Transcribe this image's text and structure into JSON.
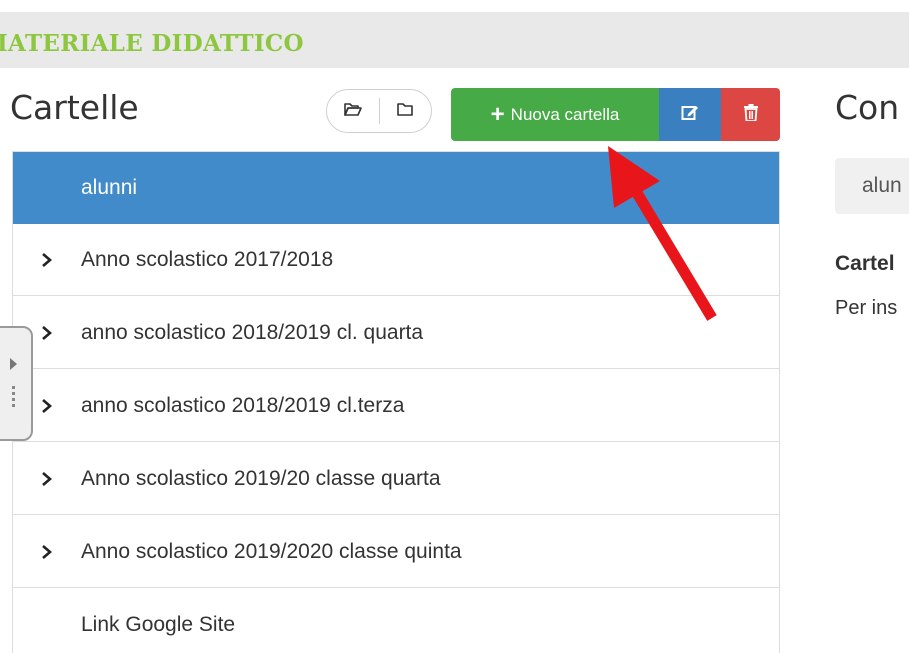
{
  "banner": {
    "title": "IATERIALE DIDATTICO"
  },
  "folders_panel": {
    "title": "Cartelle",
    "expand_all_icon": "folder-open-icon",
    "collapse_all_icon": "folder-icon",
    "new_folder_label": "Nuova cartella",
    "edit_icon": "edit-icon",
    "delete_icon": "trash-icon",
    "items": [
      {
        "label": "alunni",
        "active": true,
        "expandable": false
      },
      {
        "label": "Anno scolastico 2017/2018",
        "active": false,
        "expandable": true
      },
      {
        "label": "anno scolastico 2018/2019 cl. quarta",
        "active": false,
        "expandable": true
      },
      {
        "label": "anno scolastico 2018/2019 cl.terza",
        "active": false,
        "expandable": true
      },
      {
        "label": "Anno scolastico 2019/20 classe quarta",
        "active": false,
        "expandable": true
      },
      {
        "label": "Anno scolastico 2019/2020 classe quinta",
        "active": false,
        "expandable": true
      },
      {
        "label": "Link Google Site",
        "active": false,
        "expandable": false
      }
    ]
  },
  "content_panel": {
    "title": "Con",
    "search_value": "alun",
    "heading": "Cartel",
    "text": "Per ins"
  },
  "colors": {
    "banner_title": "#8dc63f",
    "new_button": "#46aa47",
    "edit_button": "#3a7fc0",
    "delete_button": "#dc4744",
    "active_row": "#428bca",
    "annotation_arrow": "#e8161b"
  }
}
